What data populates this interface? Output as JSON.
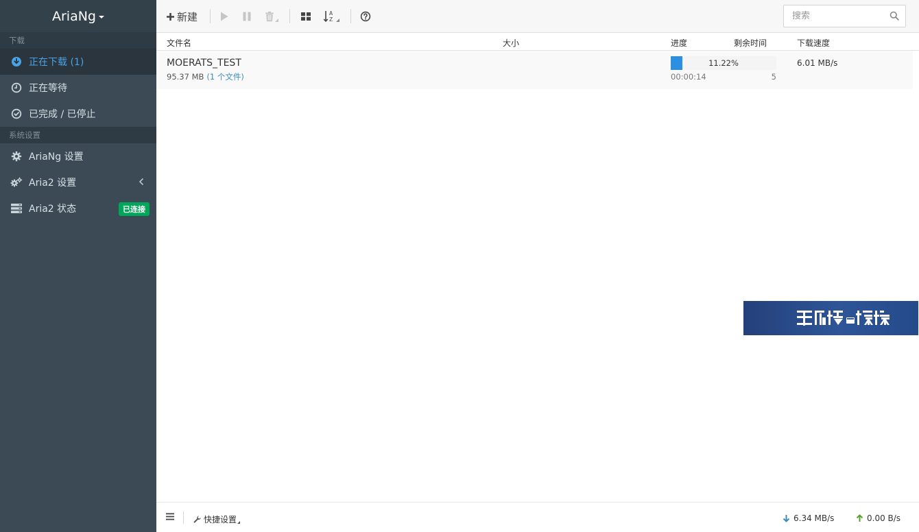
{
  "app": {
    "brand": "AriaNg"
  },
  "sidebar": {
    "sections": {
      "download": "下载",
      "settings": "系统设置"
    },
    "items": [
      {
        "label": "正在下载 (1)",
        "icon": "download-circle-icon"
      },
      {
        "label": "正在等待",
        "icon": "clock-icon"
      },
      {
        "label": "已完成 / 已停止",
        "icon": "check-circle-icon"
      },
      {
        "label": "AriaNg 设置",
        "icon": "gear-icon"
      },
      {
        "label": "Aria2 设置",
        "icon": "gears-icon"
      },
      {
        "label": "Aria2 状态",
        "icon": "server-icon",
        "badge": "已连接"
      }
    ]
  },
  "toolbar": {
    "new_label": "新建",
    "search_placeholder": "搜索"
  },
  "table": {
    "headers": {
      "name": "文件名",
      "size": "大小",
      "progress": "进度",
      "remaining": "剩余时间",
      "speed": "下载速度"
    },
    "rows": [
      {
        "name": "MOERATS_TEST",
        "size": "95.37 MB",
        "file_count": "(1 个文件)",
        "progress_text": "11.22%",
        "progress_fraction": 0.1122,
        "eta": "00:00:14",
        "connections": "5",
        "speed": "6.01 MB/s"
      }
    ]
  },
  "footer": {
    "quick_settings": "快捷设置",
    "download_speed": "6.34 MB/s",
    "upload_speed": "0.00 B/s"
  },
  "colors": {
    "sidebar_bg": "#3b4a55",
    "accent": "#2d8fe0",
    "connected_badge": "#00a65a"
  }
}
